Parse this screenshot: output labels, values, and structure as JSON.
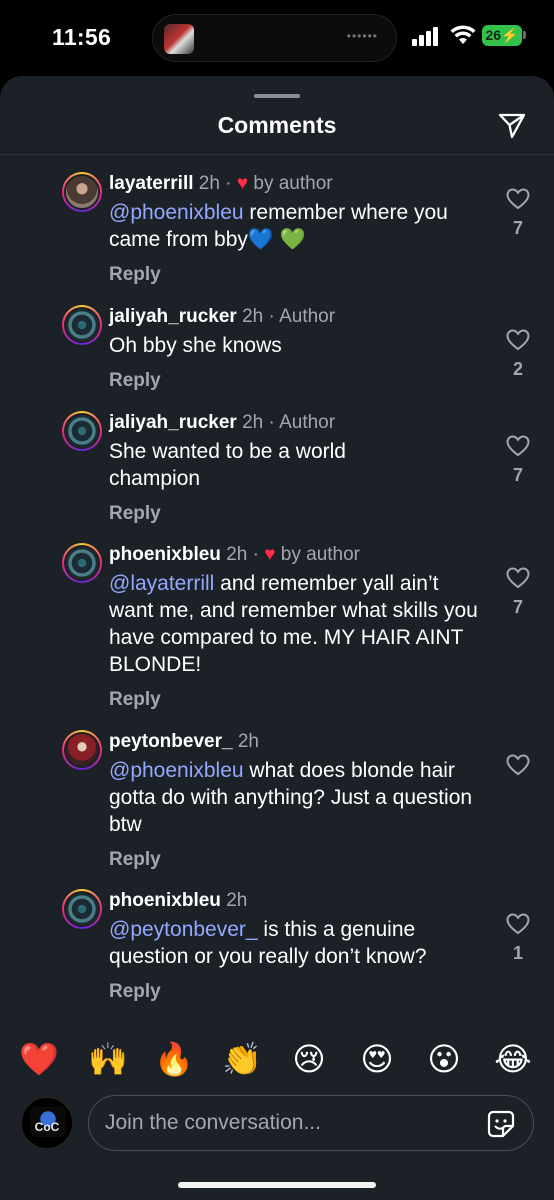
{
  "status_bar": {
    "time": "11:56",
    "battery": "26"
  },
  "header": {
    "title": "Comments"
  },
  "comments": [
    {
      "username": "layaterrill",
      "time": "2h",
      "separator": "·",
      "tag": "by author",
      "tag_type": "liked",
      "mention": "@phoenixbleu",
      "text": " remember where you came from bby💙 💚",
      "likes": "7",
      "reply": "Reply"
    },
    {
      "username": "jaliyah_rucker",
      "time": "2h",
      "separator": "·",
      "tag": "Author",
      "tag_type": "author",
      "mention": "",
      "text": "Oh bby she knows",
      "likes": "2",
      "reply": "Reply"
    },
    {
      "username": "jaliyah_rucker",
      "time": "2h",
      "separator": "·",
      "tag": "Author",
      "tag_type": "author",
      "mention": "",
      "text": "She wanted to be a world champion",
      "likes": "7",
      "reply": "Reply"
    },
    {
      "username": "phoenixbleu",
      "time": "2h",
      "separator": "·",
      "tag": "by author",
      "tag_type": "liked",
      "mention": "@layaterrill",
      "text": " and remember yall ain’t want me, and remember what skills you have compared to me. MY HAIR AINT BLONDE!",
      "likes": "7",
      "reply": "Reply"
    },
    {
      "username": "peytonbever_",
      "time": "2h",
      "separator": "",
      "tag": "",
      "tag_type": "none",
      "mention": "@phoenixbleu",
      "text": " what does blonde hair gotta do with anything? Just a question btw",
      "likes": "",
      "reply": "Reply"
    },
    {
      "username": "phoenixbleu",
      "time": "2h",
      "separator": "",
      "tag": "",
      "tag_type": "none",
      "mention": "@peytonbever_",
      "text": " is this a genuine question or you really don’t know?",
      "likes": "1",
      "reply": "Reply"
    }
  ],
  "reactions": [
    "❤️",
    "🙌",
    "🔥",
    "👏",
    "😢",
    "😍",
    "😮",
    "😂"
  ],
  "composer": {
    "placeholder": "Join the conversation...",
    "avatar_label": "CoC"
  },
  "colors": {
    "sheet_bg": "#1c2027",
    "mention": "#93a8ff",
    "heart": "#ff2e45",
    "battery": "#33c14b"
  }
}
